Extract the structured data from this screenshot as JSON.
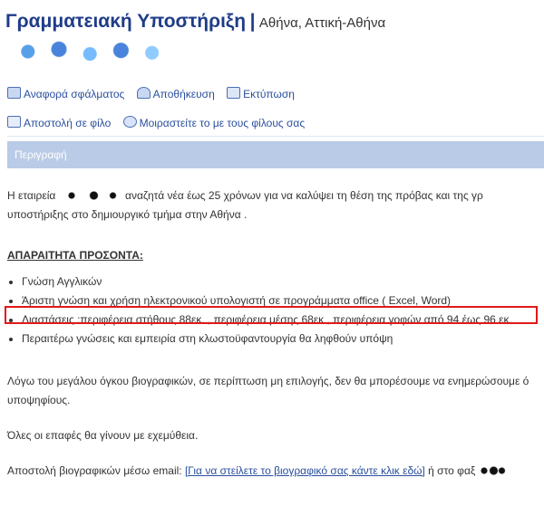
{
  "header": {
    "title": "Γραμματειακή Υποστήριξη",
    "divider": "|",
    "location": "Αθήνα, Αττική-Αθήνα"
  },
  "actions_row1": [
    {
      "label": "Αναφορά σφάλματος",
      "icon": "flag-icon"
    },
    {
      "label": "Αποθήκευση",
      "icon": "person-icon"
    },
    {
      "label": "Εκτύπωση",
      "icon": "printer-icon"
    }
  ],
  "actions_row2": [
    {
      "label": "Αποστολή σε φίλο",
      "icon": "mail-icon"
    },
    {
      "label": "Μοιραστείτε το με τους φίλους σας",
      "icon": "share-icon"
    }
  ],
  "section": {
    "title": "Περιγραφή"
  },
  "body": {
    "intro_a": "Η εταιρεία",
    "intro_b": "αναζητά νέα έως 25 χρόνων για να καλύψει τη θέση της πρόβας και της γρ",
    "intro_line2": "υποστήριξης στο δημιουργικό τμήμα στην Αθήνα .",
    "requirements_title": "ΑΠΑΡΑΙΤΗΤΑ ΠΡΟΣΟΝΤΑ:",
    "requirements": [
      "Γνώση Αγγλικών",
      "Άριστη γνώση και χρήση ηλεκτρονικού υπολογιστή σε προγράμματα office ( Excel, Word)",
      "Διαστάσεις :περιφέρεια στήθους 88εκ. , περιφέρεια μέσης 68εκ , περιφέρεια γοφών από 94 έως 96 εκ.",
      "Περαιτέρω γνώσεις και εμπειρία στη κλωστοϋφαντουργία θα ληφθούν υπόψη"
    ],
    "notice_line1": "Λόγω του μεγάλου όγκου βιογραφικών, σε περίπτωση μη επιλογής, δεν θα μπορέσουμε να ενημερώσουμε ό",
    "notice_line2": "υποψηφίους.",
    "confidential": "Όλες οι επαφές θα γίνουν με εχεμύθεια.",
    "cv_label": "Αποστολή βιογραφικών μέσω email:",
    "cv_link": "[Για να στείλετε το βιογραφικό σας κάντε κλικ εδώ]",
    "cv_fax": "ή στο φαξ"
  }
}
